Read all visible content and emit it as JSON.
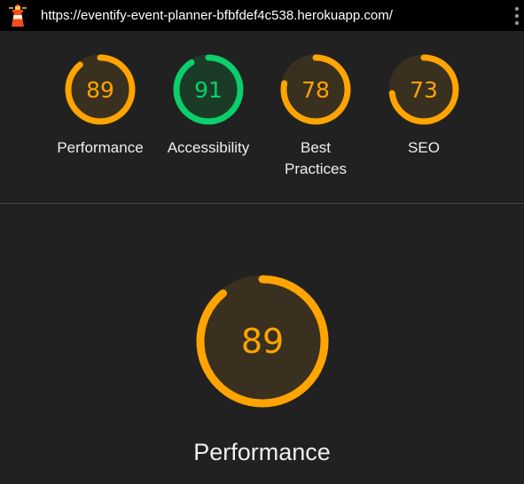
{
  "browser": {
    "url": "https://eventify-event-planner-bfbfdef4c538.herokuapp.com/"
  },
  "icons": {
    "logo": "lighthouse-icon",
    "menu": "more-vertical-icon"
  },
  "colors": {
    "pass": "#0cce6b",
    "average": "#ffa400",
    "pass_bg": "#1b3b27",
    "average_bg": "#3a3020"
  },
  "categories": [
    {
      "id": "performance",
      "label": "Performance",
      "score": 89,
      "status": "average"
    },
    {
      "id": "accessibility",
      "label": "Accessibility",
      "score": 91,
      "status": "pass"
    },
    {
      "id": "best-practices",
      "label": "Best Practices",
      "score": 78,
      "status": "average"
    },
    {
      "id": "seo",
      "label": "SEO",
      "score": 73,
      "status": "average"
    }
  ],
  "selected": {
    "label": "Performance",
    "score": 89,
    "status": "average"
  }
}
